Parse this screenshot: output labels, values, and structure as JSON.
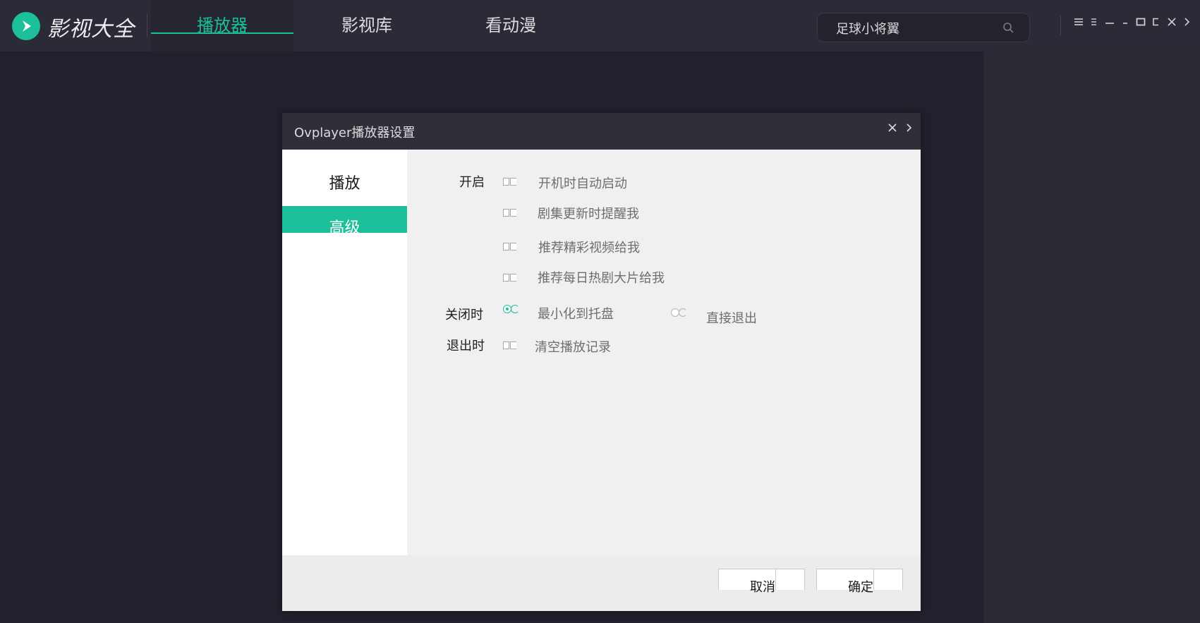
{
  "app": {
    "brand": "影视大全"
  },
  "nav": {
    "tabs": [
      {
        "label": "播放器"
      },
      {
        "label": "影视库"
      },
      {
        "label": "看动漫"
      }
    ]
  },
  "search": {
    "value": "足球小将翼"
  },
  "dialog": {
    "title": "Ovplayer播放器设置",
    "side": [
      {
        "label": "播放"
      },
      {
        "label": "高级"
      }
    ],
    "labels": {
      "startup": "开启",
      "on_close": "关闭时",
      "on_exit": "退出时"
    },
    "options": {
      "auto_start": "开机时自动启动",
      "notify_update": "剧集更新时提醒我",
      "recommend_videos": "推荐精彩视频给我",
      "recommend_daily": "推荐每日热剧大片给我",
      "minimize_tray": "最小化到托盘",
      "exit_directly": "直接退出",
      "clear_history": "清空播放记录"
    },
    "buttons": {
      "cancel": "取消",
      "ok": "确定"
    }
  },
  "colors": {
    "accent": "#1bbf9a",
    "topbar": "#2b2b37",
    "background": "#21212d"
  }
}
